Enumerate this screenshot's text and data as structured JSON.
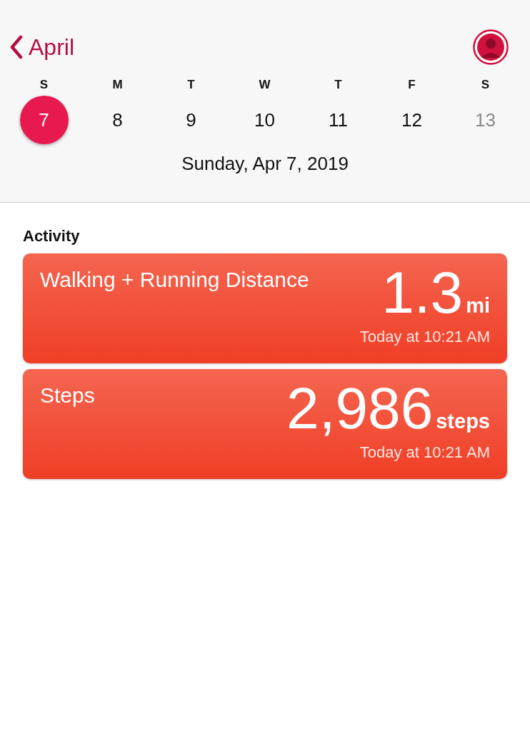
{
  "nav": {
    "back_label": "April"
  },
  "week": [
    {
      "weekday": "S",
      "day": "7",
      "selected": true,
      "disabled": false
    },
    {
      "weekday": "M",
      "day": "8",
      "selected": false,
      "disabled": false
    },
    {
      "weekday": "T",
      "day": "9",
      "selected": false,
      "disabled": false
    },
    {
      "weekday": "W",
      "day": "10",
      "selected": false,
      "disabled": false
    },
    {
      "weekday": "T",
      "day": "11",
      "selected": false,
      "disabled": false
    },
    {
      "weekday": "F",
      "day": "12",
      "selected": false,
      "disabled": false
    },
    {
      "weekday": "S",
      "day": "13",
      "selected": false,
      "disabled": true
    }
  ],
  "date_title": "Sunday, Apr 7, 2019",
  "section_title": "Activity",
  "cards": [
    {
      "title": "Walking + Running Distance",
      "value": "1.3",
      "unit": "mi",
      "time": "Today at 10:21 AM"
    },
    {
      "title": "Steps",
      "value": "2,986",
      "unit": "steps",
      "time": "Today at 10:21 AM"
    }
  ]
}
